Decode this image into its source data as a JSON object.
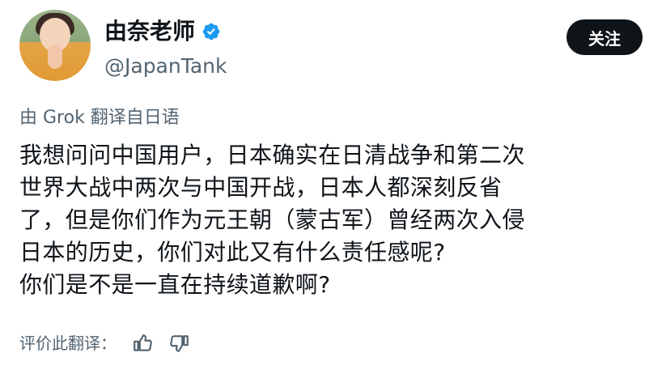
{
  "profile": {
    "name": "由奈老师",
    "handle": "@JapanTank",
    "follow_label": "关注"
  },
  "translation": {
    "label": "由 Grok 翻译自日语"
  },
  "post": {
    "text": "我想问问中国用户，日本确实在日清战争和第二次\n世界大战中两次与中国开战，日本人都深刻反省\n了，但是你们作为元王朝（蒙古军）曾经两次入侵\n日本的历史，你们对此又有什么责任感呢?\n你们是不是一直在持续道歉啊?"
  },
  "rating": {
    "label": "评价此翻译："
  },
  "icons": {
    "verified": "verified-badge-icon",
    "like": "thumbs-up-icon",
    "dislike": "thumbs-down-icon"
  },
  "colors": {
    "text": "#0f1419",
    "secondary_text": "#536471",
    "verified_blue": "#1d9bf0",
    "button_bg": "#0f1419",
    "button_text": "#ffffff"
  }
}
